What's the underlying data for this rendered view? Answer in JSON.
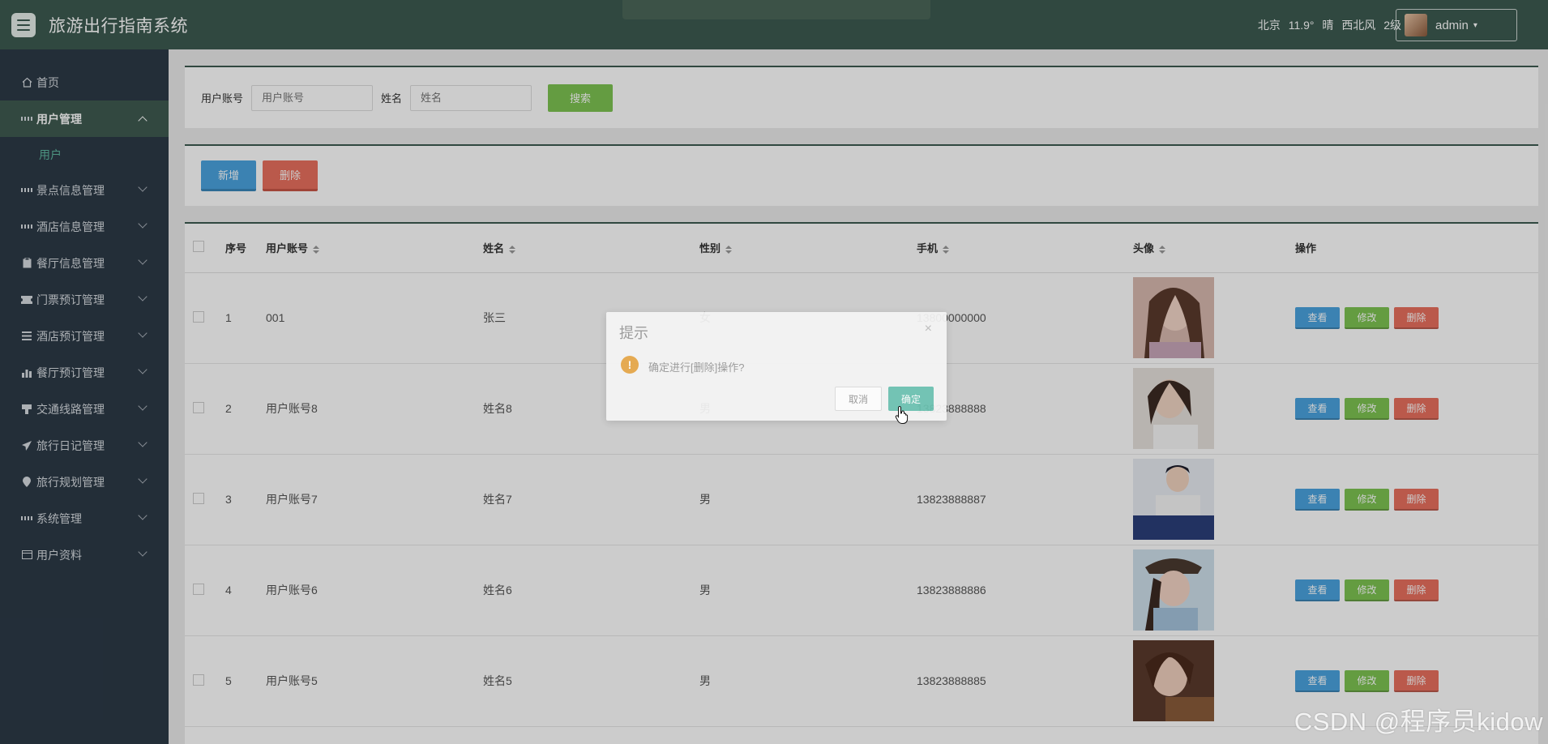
{
  "header": {
    "title": "旅游出行指南系统",
    "weather": {
      "city": "北京",
      "temp": "11.9°",
      "condition": "晴",
      "wind": "西北风",
      "level": "2级"
    },
    "user": "admin"
  },
  "sidebar": {
    "items": [
      {
        "label": "首页",
        "icon": "home-icon"
      },
      {
        "label": "用户管理",
        "icon": "grid-icon",
        "active": true,
        "sub": [
          "用户"
        ]
      },
      {
        "label": "景点信息管理",
        "icon": "grid-icon"
      },
      {
        "label": "酒店信息管理",
        "icon": "grid-icon"
      },
      {
        "label": "餐厅信息管理",
        "icon": "clipboard-icon"
      },
      {
        "label": "门票预订管理",
        "icon": "ticket-icon"
      },
      {
        "label": "酒店预订管理",
        "icon": "list-icon"
      },
      {
        "label": "餐厅预订管理",
        "icon": "bar-chart-icon"
      },
      {
        "label": "交通线路管理",
        "icon": "road-icon"
      },
      {
        "label": "旅行日记管理",
        "icon": "send-icon"
      },
      {
        "label": "旅行规划管理",
        "icon": "pin-icon"
      },
      {
        "label": "系统管理",
        "icon": "grid-icon"
      },
      {
        "label": "用户资料",
        "icon": "card-icon"
      }
    ]
  },
  "search": {
    "account_label": "用户账号",
    "account_placeholder": "用户账号",
    "name_label": "姓名",
    "name_placeholder": "姓名",
    "button": "搜索"
  },
  "actions": {
    "add": "新增",
    "delete": "删除"
  },
  "table": {
    "headers": [
      "序号",
      "用户账号",
      "姓名",
      "性别",
      "手机",
      "头像",
      "操作"
    ],
    "rows": [
      {
        "no": "1",
        "account": "001",
        "name": "张三",
        "gender": "女",
        "phone": "13800000000"
      },
      {
        "no": "2",
        "account": "用户账号8",
        "name": "姓名8",
        "gender": "男",
        "phone": "13823888888"
      },
      {
        "no": "3",
        "account": "用户账号7",
        "name": "姓名7",
        "gender": "男",
        "phone": "13823888887"
      },
      {
        "no": "4",
        "account": "用户账号6",
        "name": "姓名6",
        "gender": "男",
        "phone": "13823888886"
      },
      {
        "no": "5",
        "account": "用户账号5",
        "name": "姓名5",
        "gender": "男",
        "phone": "13823888885"
      }
    ],
    "op_view": "查看",
    "op_edit": "修改",
    "op_delete": "删除"
  },
  "dialog": {
    "title": "提示",
    "close": "×",
    "message": "确定进行[删除]操作?",
    "cancel": "取消",
    "ok": "确定"
  },
  "watermark": "CSDN @程序员kidow",
  "colors": {
    "header": "#3c5a50",
    "sidebar": "#2c3a47",
    "primary": "#4aa3df",
    "success": "#7dc452",
    "danger": "#e9705e"
  }
}
